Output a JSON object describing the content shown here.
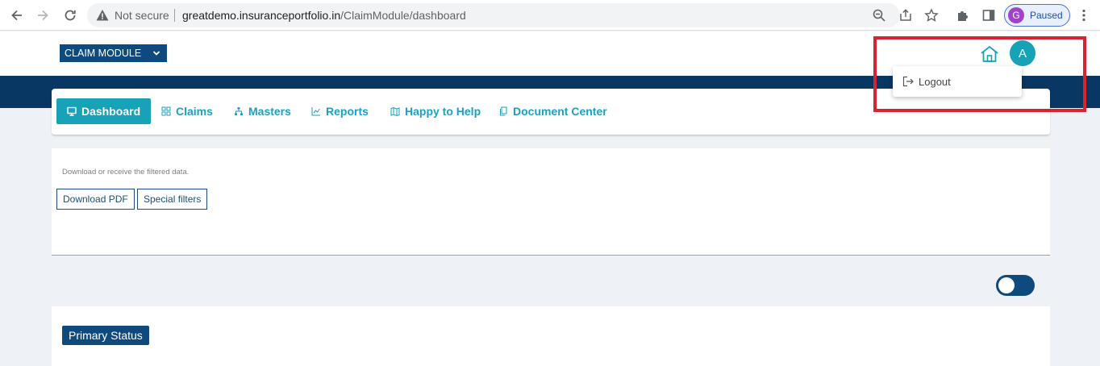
{
  "browser": {
    "security_label": "Not secure",
    "url_host": "greatdemo.insuranceportfolio.in",
    "url_path": "/ClaimModule/dashboard",
    "profile_initial": "G",
    "profile_status": "Paused"
  },
  "header": {
    "module_label": "CLAIM MODULE",
    "avatar_initial": "A"
  },
  "user_menu": {
    "items": [
      {
        "label": "Logout",
        "icon": "logout-icon"
      }
    ]
  },
  "nav": {
    "tabs": [
      {
        "label": "Dashboard",
        "icon": "monitor-icon",
        "active": true
      },
      {
        "label": "Claims",
        "icon": "grid-icon",
        "active": false
      },
      {
        "label": "Masters",
        "icon": "sitemap-icon",
        "active": false
      },
      {
        "label": "Reports",
        "icon": "chart-icon",
        "active": false
      },
      {
        "label": "Happy to Help",
        "icon": "map-icon",
        "active": false
      },
      {
        "label": "Document Center",
        "icon": "documents-icon",
        "active": false
      }
    ]
  },
  "filters": {
    "hint": "Download or receive the filtered data.",
    "download_pdf_label": "Download PDF",
    "special_filters_label": "Special filters"
  },
  "toggle": {
    "on": true
  },
  "status": {
    "title": "Primary Status"
  },
  "colors": {
    "brand_navy": "#0f4a7e",
    "band_navy": "#083763",
    "accent_teal": "#17a2b8",
    "highlight_red": "#d9232d"
  }
}
